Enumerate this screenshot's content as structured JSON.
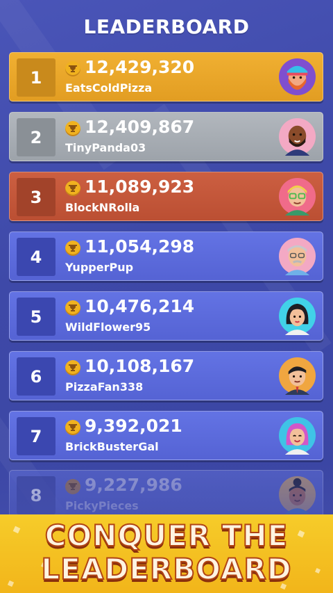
{
  "header": {
    "title": "LEADERBOARD"
  },
  "leaderboard": [
    {
      "rank": "1",
      "score": "12,429,320",
      "name": "EatsColdPizza"
    },
    {
      "rank": "2",
      "score": "12,409,867",
      "name": "TinyPanda03"
    },
    {
      "rank": "3",
      "score": "11,089,923",
      "name": "BlockNRolla"
    },
    {
      "rank": "4",
      "score": "11,054,298",
      "name": "YupperPup"
    },
    {
      "rank": "5",
      "score": "10,476,214",
      "name": "WildFlower95"
    },
    {
      "rank": "6",
      "score": "10,108,167",
      "name": "PizzaFan338"
    },
    {
      "rank": "7",
      "score": "9,392,021",
      "name": "BrickBusterGal"
    },
    {
      "rank": "8",
      "score": "9,227,986",
      "name": "PickyPieces"
    }
  ],
  "banner": {
    "line1": "CONQUER THE",
    "line2": "LEADERBOARD"
  },
  "colors": {
    "background": "#4a55b8",
    "gold_row": "#eaa62b",
    "silver_row": "#a7adb4",
    "bronze_row": "#c3573a",
    "blue_row": "#5b69da",
    "banner": "#f4c21f"
  }
}
